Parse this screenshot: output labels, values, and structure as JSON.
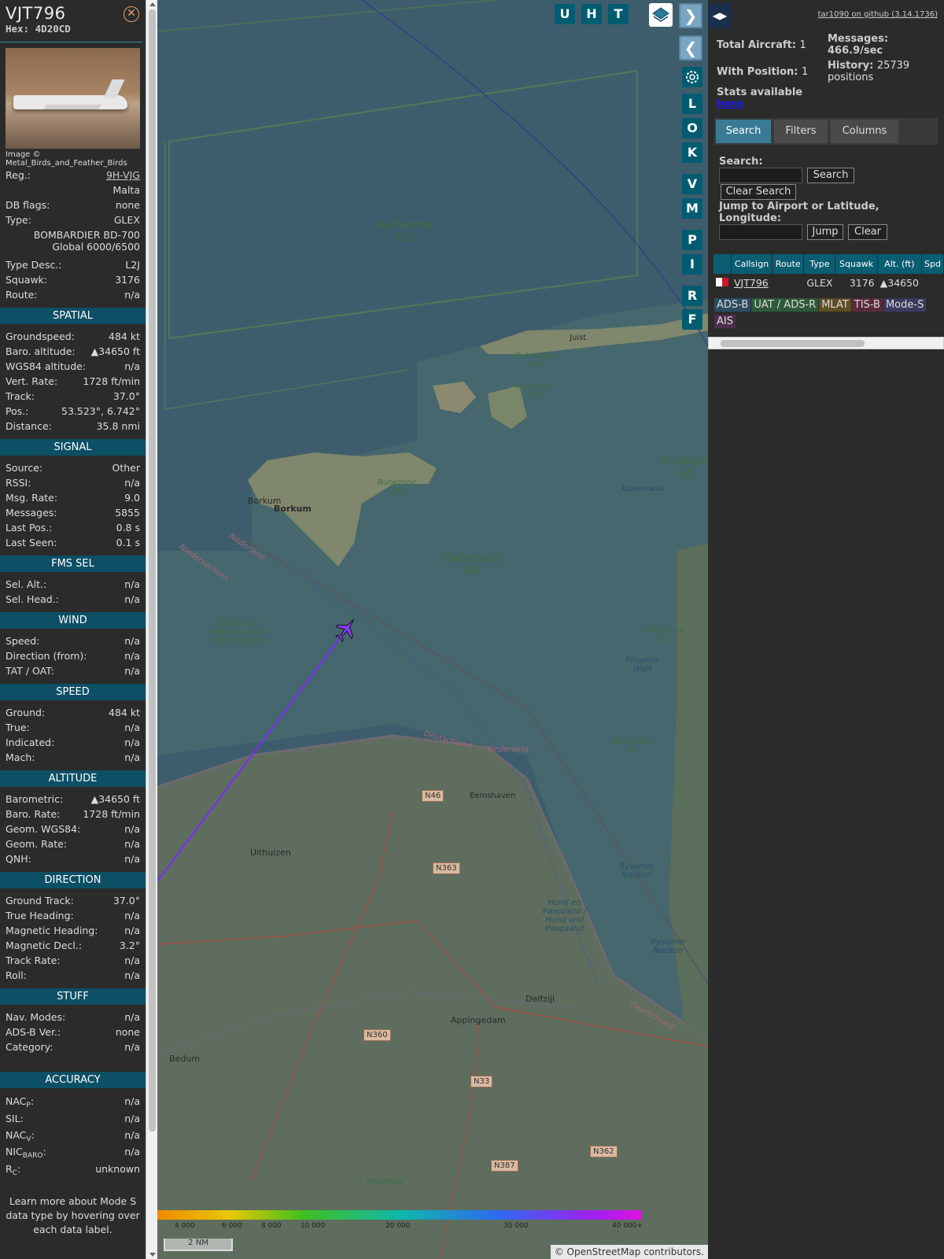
{
  "aircraft": {
    "callsign": "VJT796",
    "hex_label": "Hex:",
    "hex": "4D20CD",
    "image_credit": "Image © Metal_Birds_and_Feather_Birds",
    "reg_label": "Reg.:",
    "reg": "9H-VJG",
    "country": "Malta",
    "db_flags_label": "DB flags:",
    "db_flags": "none",
    "type_label": "Type:",
    "type": "GLEX",
    "type_full_1": "BOMBARDIER BD-700",
    "type_full_2": "Global 6000/6500",
    "type_desc_label": "Type Desc.:",
    "type_desc": "L2J",
    "squawk_label": "Squawk:",
    "squawk": "3176",
    "route_label": "Route:",
    "route": "n/a"
  },
  "sections": {
    "spatial": {
      "title": "SPATIAL",
      "rows": [
        {
          "label": "Groundspeed:",
          "value": "484 kt"
        },
        {
          "label": "Baro. altitude:",
          "value": "▲34650 ft"
        },
        {
          "label": "WGS84 altitude:",
          "value": "n/a"
        },
        {
          "label": "Vert. Rate:",
          "value": "1728 ft/min"
        },
        {
          "label": "Track:",
          "value": "37.0°"
        },
        {
          "label": "Pos.:",
          "value": "53.523°, 6.742°"
        },
        {
          "label": "Distance:",
          "value": "35.8 nmi"
        }
      ]
    },
    "signal": {
      "title": "SIGNAL",
      "rows": [
        {
          "label": "Source:",
          "value": "Other"
        },
        {
          "label": "RSSI:",
          "value": "n/a"
        },
        {
          "label": "Msg. Rate:",
          "value": "9.0"
        },
        {
          "label": "Messages:",
          "value": "5855"
        },
        {
          "label": "Last Pos.:",
          "value": "0.8 s"
        },
        {
          "label": "Last Seen:",
          "value": "0.1 s"
        }
      ]
    },
    "fms": {
      "title": "FMS SEL",
      "rows": [
        {
          "label": "Sel. Alt.:",
          "value": "n/a"
        },
        {
          "label": "Sel. Head.:",
          "value": "n/a"
        }
      ]
    },
    "wind": {
      "title": "WIND",
      "rows": [
        {
          "label": "Speed:",
          "value": "n/a"
        },
        {
          "label": "Direction (from):",
          "value": "n/a"
        },
        {
          "label": "TAT / OAT:",
          "value": "n/a"
        }
      ]
    },
    "speed": {
      "title": "SPEED",
      "rows": [
        {
          "label": "Ground:",
          "value": "484 kt"
        },
        {
          "label": "True:",
          "value": "n/a"
        },
        {
          "label": "Indicated:",
          "value": "n/a"
        },
        {
          "label": "Mach:",
          "value": "n/a"
        }
      ]
    },
    "altitude": {
      "title": "ALTITUDE",
      "rows": [
        {
          "label": "Barometric:",
          "value": "▲34650 ft"
        },
        {
          "label": "Baro. Rate:",
          "value": "1728 ft/min"
        },
        {
          "label": "Geom. WGS84:",
          "value": "n/a"
        },
        {
          "label": "Geom. Rate:",
          "value": "n/a"
        },
        {
          "label": "QNH:",
          "value": "n/a"
        }
      ]
    },
    "direction": {
      "title": "DIRECTION",
      "rows": [
        {
          "label": "Ground Track:",
          "value": "37.0°"
        },
        {
          "label": "True Heading:",
          "value": "n/a"
        },
        {
          "label": "Magnetic Heading:",
          "value": "n/a"
        },
        {
          "label": "Magnetic Decl.:",
          "value": "3.2°"
        },
        {
          "label": "Track Rate:",
          "value": "n/a"
        },
        {
          "label": "Roll:",
          "value": "n/a"
        }
      ]
    },
    "stuff": {
      "title": "STUFF",
      "rows": [
        {
          "label": "Nav. Modes:",
          "value": "n/a"
        },
        {
          "label": "ADS-B Ver.:",
          "value": "none"
        },
        {
          "label": "Category:",
          "value": "n/a"
        }
      ]
    },
    "accuracy": {
      "title": "ACCURACY",
      "nacp_main": "NAC",
      "nacp_sub": "P",
      "nacp_value": "n/a",
      "sil_label": "SIL:",
      "sil_value": "n/a",
      "nacv_main": "NAC",
      "nacv_sub": "V",
      "nacv_value": "n/a",
      "nicbaro_main": "NIC",
      "nicbaro_sub": "BARO",
      "nicbaro_value": "n/a",
      "rc_main": "R",
      "rc_sub": "C",
      "rc_value": "unknown"
    }
  },
  "tip": "Learn more about Mode S data type by hovering over each data label.",
  "map": {
    "top_buttons": [
      "U",
      "H",
      "T"
    ],
    "side_buttons": [
      "L",
      "O",
      "K",
      "V",
      "M",
      "P",
      "I",
      "R",
      "F"
    ],
    "labels": {
      "rz12a": "Ruhezone",
      "rz12b": "I/12",
      "rz6a": "Ruhezone",
      "rz6b": "I/6",
      "rz5a": "Ruhezon",
      "rz5b": "I/5",
      "rz14a": "Ruhezone",
      "rz14b": "I/14",
      "rz13a": "Ruhezone",
      "rz13b": "I/13",
      "rz8a": "Ruhezone",
      "rz8b": "I/8",
      "rz3a": "Ruhezone",
      "rz3b": "I/3",
      "rz2a": "Ruhezone",
      "rz2b": "I/2",
      "borkum1": "Borkum",
      "borkum2": "Borkum",
      "juist": "Juist",
      "eemshaven": "Eemshaven",
      "uithuizen": "Uithuizen",
      "appingedam": "Appingedam",
      "delfzijl": "Delfzijl",
      "bedum": "Bedum",
      "roegwold": "'t Roegwold",
      "sparregat1": "Sparregat",
      "sparregat2": "Horsbornzand",
      "sparregat3": "Horsbornzand",
      "kopersand": "Kopersand",
      "pilsum1": "Pilsumer",
      "pilsum2": "Watt",
      "rysum1": "Rysumer",
      "rysum2": "Nacken",
      "rysum3": "Rysumer",
      "rysum4": "Nacken",
      "hond1": "Hond en",
      "hond2": "Paapzand /",
      "hond3": "Hund und",
      "hond4": "Paapsand",
      "nederland1": "Nederland",
      "nederland2": "Nederland",
      "niedersachsen": "Niedersachsen",
      "deutschland1": "Deutschland",
      "deutschland2": "Deutschland"
    },
    "roads": [
      "N46",
      "N363",
      "N360",
      "N33",
      "N387",
      "N362"
    ],
    "altitude_scale": [
      "4 000",
      "6 000",
      "8 000",
      "10 000",
      "20 000",
      "30 000",
      "40 000+"
    ],
    "scale_label": "2 NM",
    "attribution_prefix": "©",
    "attribution_link": "OpenStreetMap",
    "attribution_suffix": "contributors."
  },
  "right": {
    "github_link": "tar1090 on github (3.14.1736)",
    "total_aircraft_label": "Total Aircraft:",
    "total_aircraft": "1",
    "with_position_label": "With Position:",
    "with_position": "1",
    "messages_label": "Messages:",
    "messages": "466.9/sec",
    "history_label": "History:",
    "history": "25739 positions",
    "stats_label": "Stats available",
    "stats_link": "here",
    "tabs": [
      "Search",
      "Filters",
      "Columns"
    ],
    "search_label": "Search:",
    "search_button": "Search",
    "clear_search_button": "Clear Search",
    "jump_label": "Jump to Airport or Latitude, Longitude:",
    "jump_button": "Jump",
    "clear_button": "Clear",
    "table_headers": [
      "",
      "Callsign",
      "Route",
      "Type",
      "Squawk",
      "Alt. (ft)",
      "Spd"
    ],
    "table_row": {
      "callsign": "VJT796",
      "route": "",
      "type": "GLEX",
      "squawk": "3176",
      "alt": "▲34650",
      "spd": ""
    },
    "sources": [
      {
        "label": "ADS-B",
        "color": "#2c4c62"
      },
      {
        "label": "UAT / ADS-R",
        "color": "#2e5a3a"
      },
      {
        "label": "MLAT",
        "color": "#5e4e24"
      },
      {
        "label": "TIS-B",
        "color": "#5a2a3a"
      },
      {
        "label": "Mode-S",
        "color": "#3a3a5e"
      },
      {
        "label": "AIS",
        "color": "#4a2e4a"
      }
    ]
  }
}
